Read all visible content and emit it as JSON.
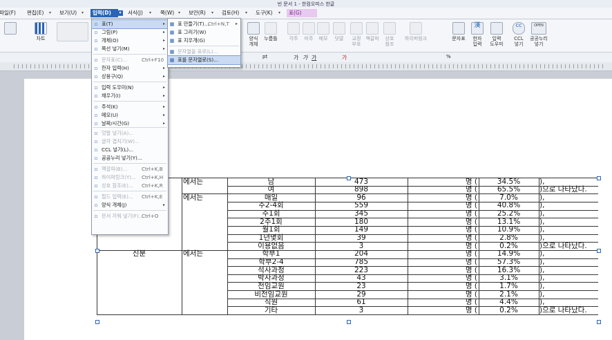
{
  "window": {
    "title": "빈 문서 1 - 한컴오피스 한글"
  },
  "menubar": {
    "items": [
      "파일(F)",
      "편집(E)",
      "보기(U)",
      "입력(D)",
      "서식(J)",
      "쪽(W)",
      "보안(R)",
      "검토(H)",
      "도구(K)",
      "표(G)"
    ]
  },
  "ribbon": {
    "chart_label": "차트",
    "form_label": "양식\n개체",
    "accumulate_label": "누름틀",
    "buttons": [
      "각주",
      "미주",
      "메모",
      "덧말",
      "교정\n부호",
      "책갈피",
      "상호\n참조",
      "하이퍼링크",
      "문자표",
      "한자\n입력",
      "입력\n도우미",
      "CCL\n넣기",
      "공공누리\n넣기"
    ],
    "ccl_icon_text": "cc",
    "open_icon_text": "OPEN",
    "hanja_icon_text": "漢"
  },
  "toolbar2": {
    "unit": "pt",
    "percent": "%"
  },
  "insert_menu": {
    "items": [
      {
        "label": "표(T)",
        "arrow": true,
        "highlight": true
      },
      {
        "label": "그림(P)",
        "arrow": true
      },
      {
        "label": "개체(O)",
        "arrow": true
      },
      {
        "label": "쪽선 넣기(M)",
        "arrow": true
      },
      {
        "label": "문자표(C)...",
        "shortcut": "Ctrl+F10",
        "disabled": true
      },
      {
        "label": "한자 입력(H)",
        "arrow": true
      },
      {
        "label": "상용구(Q)",
        "arrow": true
      },
      {
        "label": "입력 도우미(N)",
        "arrow": true
      },
      {
        "label": "채우기(I)",
        "arrow": true
      },
      {
        "label": "주석(K)",
        "arrow": true
      },
      {
        "label": "메모(U)",
        "arrow": true
      },
      {
        "label": "날짜/시간(G)",
        "arrow": true
      },
      {
        "label": "덧말 넣기(A)...",
        "disabled": true
      },
      {
        "label": "글자 겹치기(W)...",
        "disabled": true
      },
      {
        "label": "CCL 넣기(L)..."
      },
      {
        "label": "공공누리 넣기(Y)..."
      },
      {
        "label": "책갈피(B)...",
        "shortcut": "Ctrl+K,B",
        "disabled": true
      },
      {
        "label": "하이퍼링크(Y)...",
        "shortcut": "Ctrl+K,H",
        "disabled": true
      },
      {
        "label": "상호 참조(E)...",
        "shortcut": "Ctrl+K,R",
        "disabled": true
      },
      {
        "label": "필드 입력(E)...",
        "shortcut": "Ctrl+K,E",
        "disabled": true
      },
      {
        "label": "양식 개체(J)",
        "arrow": true
      },
      {
        "label": "문서 끼워 넣기(F)...",
        "shortcut": "Ctrl+O",
        "disabled": true
      }
    ]
  },
  "table_submenu": {
    "items": [
      {
        "label": "표 만들기(T)...",
        "shortcut": "Ctrl+N,T",
        "arrow": true
      },
      {
        "label": "표 그리기(W)"
      },
      {
        "label": "표 지우개(G)"
      },
      {
        "label": "문자열을 표로(L)...",
        "disabled": true
      },
      {
        "label": "표를 문자열로(S)...",
        "highlight": true
      }
    ]
  },
  "document": {
    "rows": [
      {
        "group": "",
        "ending": "에서는",
        "item": "남",
        "count": "473",
        "unit": "명 (",
        "pct": "34.5%",
        "tail": "),"
      },
      {
        "group": "",
        "ending": "",
        "item": "여",
        "count": "898",
        "unit": "명 (",
        "pct": "65.5%",
        "tail": ")으로 나타났다."
      },
      {
        "group": "",
        "ending": "에서는",
        "item": "매일",
        "count": "96",
        "unit": "명 (",
        "pct": "7.0%",
        "tail": "),"
      },
      {
        "group": "",
        "ending": "",
        "item": "주2-4회",
        "count": "559",
        "unit": "명 (",
        "pct": "40.8%",
        "tail": "),"
      },
      {
        "group": "",
        "ending": "",
        "item": "주1회",
        "count": "345",
        "unit": "명 (",
        "pct": "25.2%",
        "tail": "),"
      },
      {
        "group": "",
        "ending": "",
        "item": "2주1회",
        "count": "180",
        "unit": "명 (",
        "pct": "13.1%",
        "tail": "),"
      },
      {
        "group": "",
        "ending": "",
        "item": "월1회",
        "count": "149",
        "unit": "명 (",
        "pct": "10.9%",
        "tail": "),"
      },
      {
        "group": "",
        "ending": "",
        "item": "1년몇회",
        "count": "39",
        "unit": "명 (",
        "pct": "2.8%",
        "tail": "),"
      },
      {
        "group": "",
        "ending": "",
        "item": "이용없음",
        "count": "3",
        "unit": "명 (",
        "pct": "0.2%",
        "tail": ")으로 나타났다."
      },
      {
        "group": "신분",
        "ending": "에서는",
        "item": "학부1",
        "count": "204",
        "unit": "명 (",
        "pct": "14.9%",
        "tail": "),"
      },
      {
        "group": "",
        "ending": "",
        "item": "학부2-4",
        "count": "785",
        "unit": "명 (",
        "pct": "57.3%",
        "tail": "),"
      },
      {
        "group": "",
        "ending": "",
        "item": "석사과정",
        "count": "223",
        "unit": "명 (",
        "pct": "16.3%",
        "tail": "),"
      },
      {
        "group": "",
        "ending": "",
        "item": "박사과정",
        "count": "43",
        "unit": "명 (",
        "pct": "3.1%",
        "tail": "),"
      },
      {
        "group": "",
        "ending": "",
        "item": "전임교원",
        "count": "23",
        "unit": "명 (",
        "pct": "1.7%",
        "tail": "),"
      },
      {
        "group": "",
        "ending": "",
        "item": "비전임교원",
        "count": "29",
        "unit": "명 (",
        "pct": "2.1%",
        "tail": "),"
      },
      {
        "group": "",
        "ending": "",
        "item": "직원",
        "count": "61",
        "unit": "명 (",
        "pct": "4.4%",
        "tail": "),"
      },
      {
        "group": "",
        "ending": "",
        "item": "기타",
        "count": "3",
        "unit": "명 (",
        "pct": "0.2%",
        "tail": ")으로 나타났다."
      }
    ]
  }
}
